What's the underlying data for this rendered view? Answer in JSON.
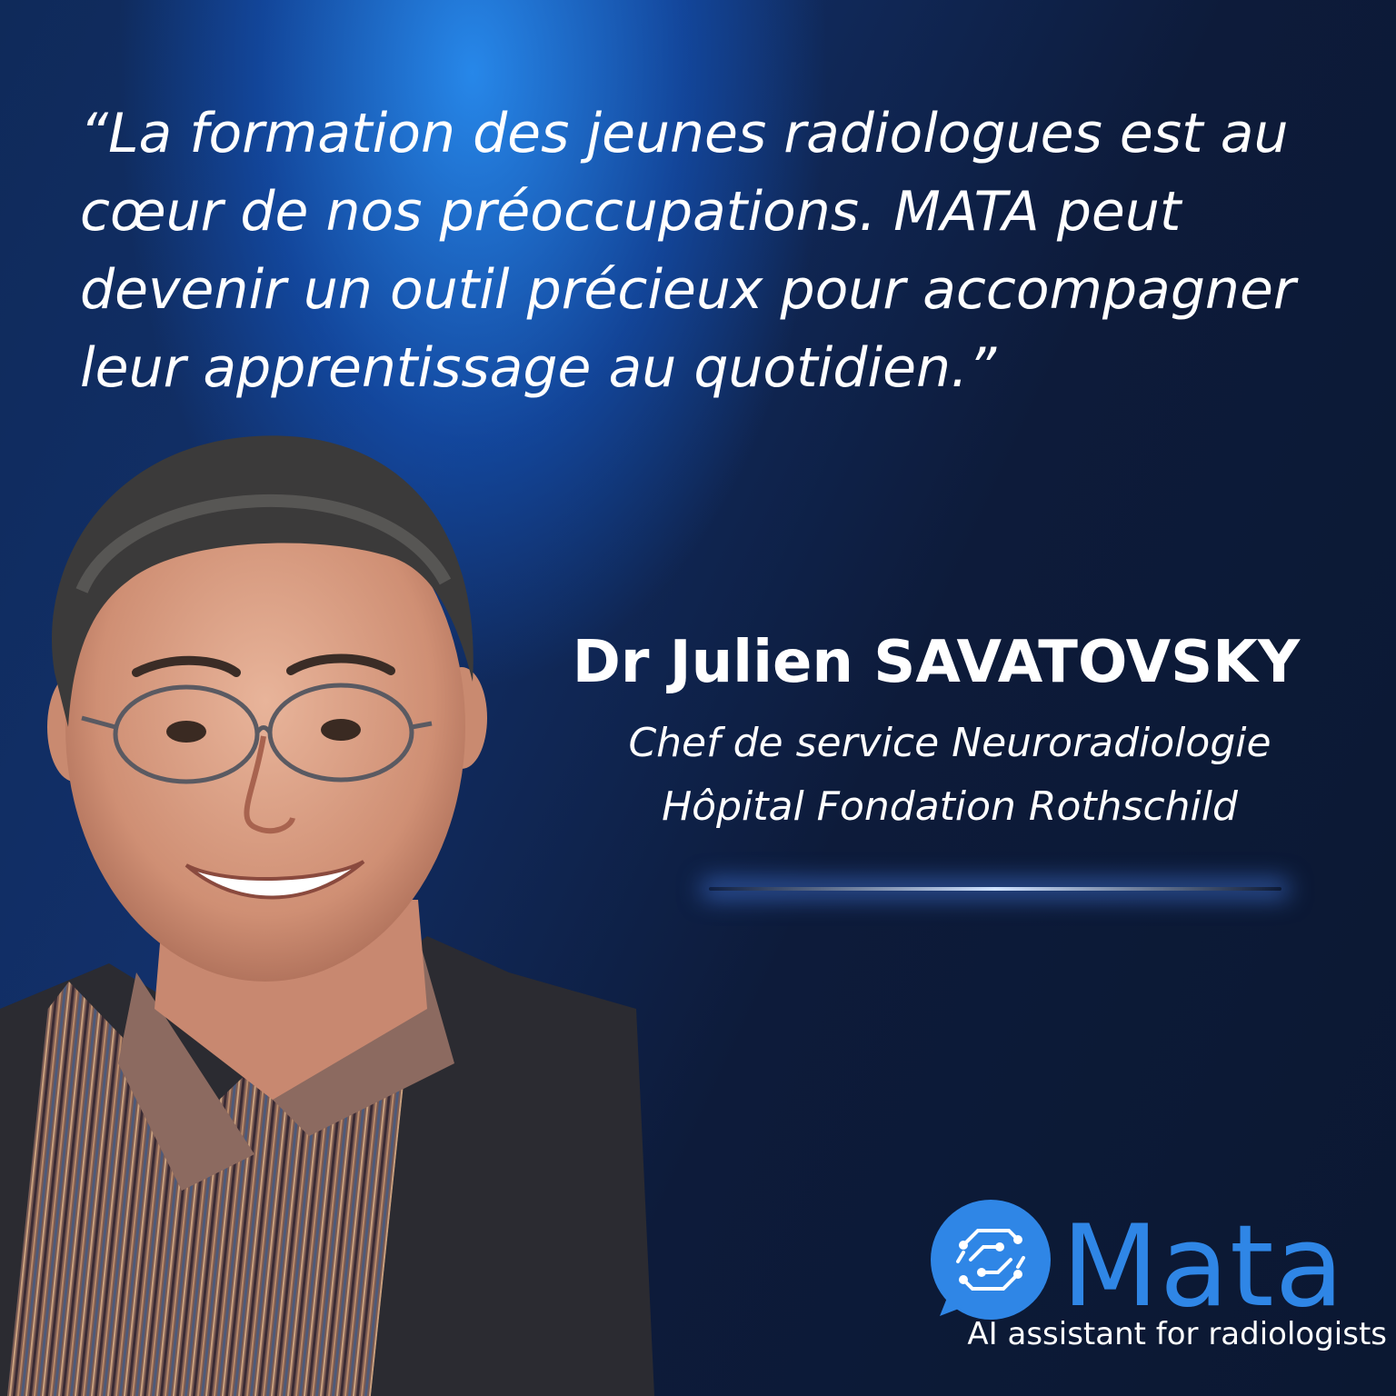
{
  "quote": {
    "line1": "“La formation des jeunes radiologues est au",
    "line2": "cœur de nos préoccupations. MATA peut",
    "line3": "devenir un outil précieux pour accompagner",
    "line4": "leur apprentissage au quotidien.”"
  },
  "person": {
    "name": "Dr  Julien SAVATOVSKY",
    "role_line1": "Chef de service Neuroradiologie",
    "role_line2": "Hôpital Fondation Rothschild"
  },
  "brand": {
    "name": "Mata",
    "tagline": "AI assistant for radiologists",
    "color": "#2f86e6"
  },
  "colors": {
    "background": "#0d1a36",
    "glow": "#1e88e5",
    "text": "#ffffff"
  }
}
